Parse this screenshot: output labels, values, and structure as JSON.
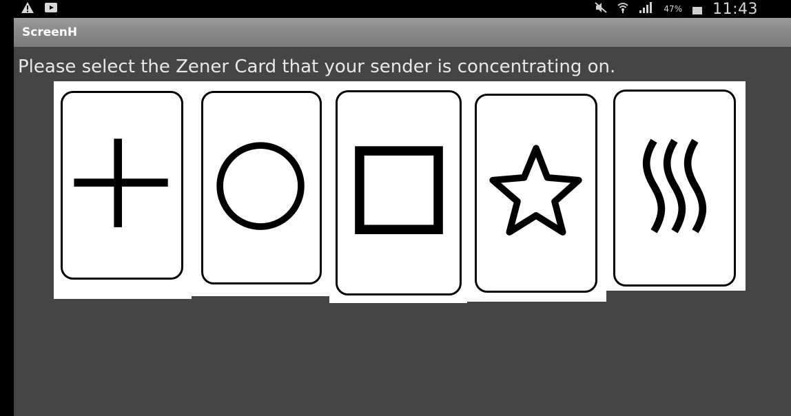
{
  "status_bar": {
    "left_icons": [
      "warning-icon",
      "media-icon"
    ],
    "right_icons": [
      "mute-icon",
      "wifi-icon",
      "signal-icon",
      "battery-icon"
    ],
    "battery_percent": "47%",
    "time": "11:43"
  },
  "app_bar": {
    "title": "ScreenH"
  },
  "main": {
    "prompt": "Please select the Zener Card that your sender is concentrating on.",
    "cards": [
      {
        "symbol": "cross"
      },
      {
        "symbol": "circle"
      },
      {
        "symbol": "square"
      },
      {
        "symbol": "star"
      },
      {
        "symbol": "waves"
      }
    ]
  },
  "colors": {
    "status_bar_bg": "#000000",
    "title_bar_bg": "#8a8a8a",
    "content_bg": "#454545",
    "card_bg": "#ffffff",
    "symbol_color": "#000000"
  }
}
